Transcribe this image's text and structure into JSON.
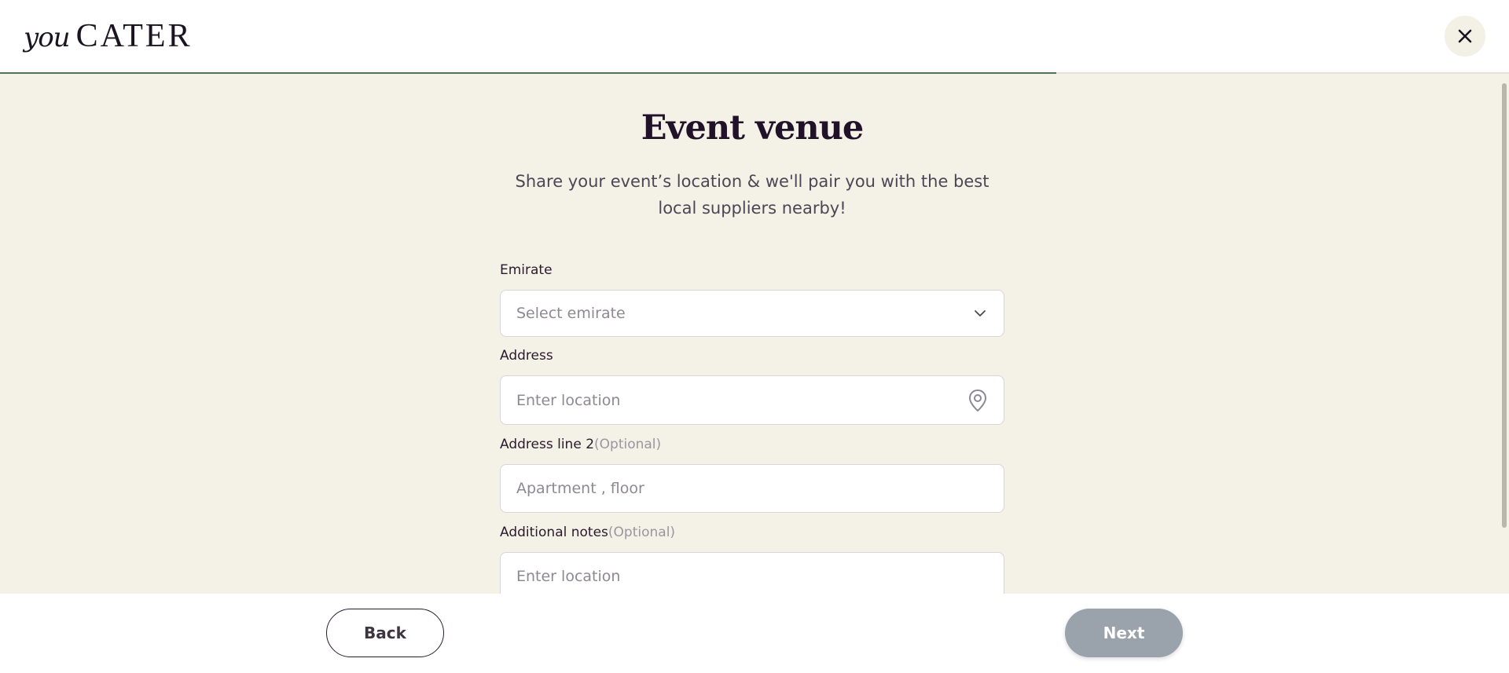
{
  "header": {
    "logo_prefix": "you",
    "logo_name": "CATER",
    "close_icon": "close-icon",
    "progress_fraction": 0.7
  },
  "main": {
    "title": "Event venue",
    "subtitle": "Share your event’s location & we'll pair you with the best local suppliers nearby!",
    "fields": {
      "emirate": {
        "label": "Emirate",
        "placeholder": "Select emirate",
        "icon": "chevron-down-icon"
      },
      "address": {
        "label": "Address",
        "placeholder": "Enter location",
        "icon": "location-pin-icon"
      },
      "address_line_2": {
        "label": "Address line 2",
        "optional": "(Optional)",
        "placeholder": "Apartment , floor"
      },
      "additional_notes": {
        "label": "Additional notes",
        "optional": "(Optional)",
        "placeholder": "Enter location"
      }
    }
  },
  "footer": {
    "back_label": "Back",
    "next_label": "Next"
  },
  "colors": {
    "background": "#f4f1e7",
    "progress": "#4f7052",
    "next_disabled": "#9aa2ab",
    "title": "#21122a"
  }
}
